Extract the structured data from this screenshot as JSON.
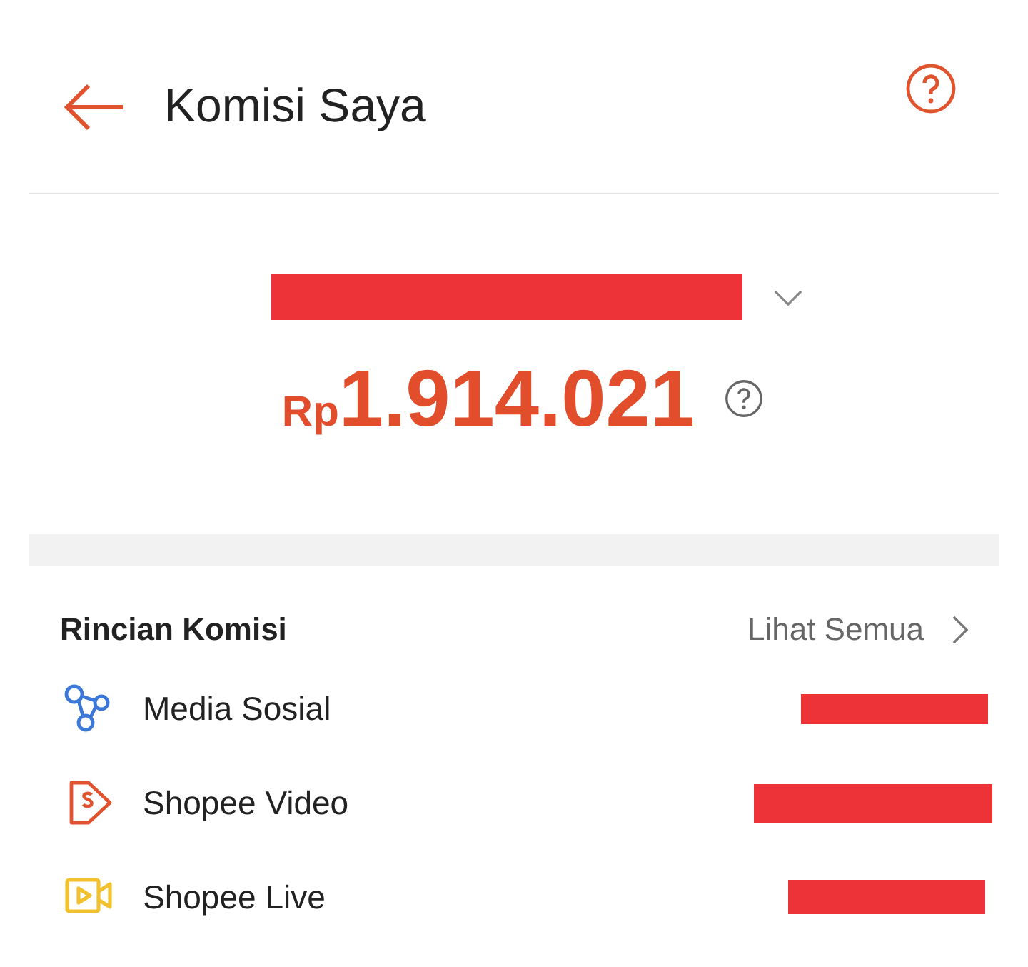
{
  "header": {
    "title": "Komisi Saya"
  },
  "summary": {
    "period_redacted": true,
    "currency": "Rp",
    "amount": "1.914.021"
  },
  "details": {
    "title": "Rincian Komisi",
    "link": "Lihat Semua",
    "rows": [
      {
        "kind": "social",
        "label": "Media Sosial",
        "value_redacted": true
      },
      {
        "kind": "video",
        "label": "Shopee Video",
        "value_redacted": true
      },
      {
        "kind": "live",
        "label": "Shopee Live",
        "value_redacted": true
      }
    ]
  }
}
